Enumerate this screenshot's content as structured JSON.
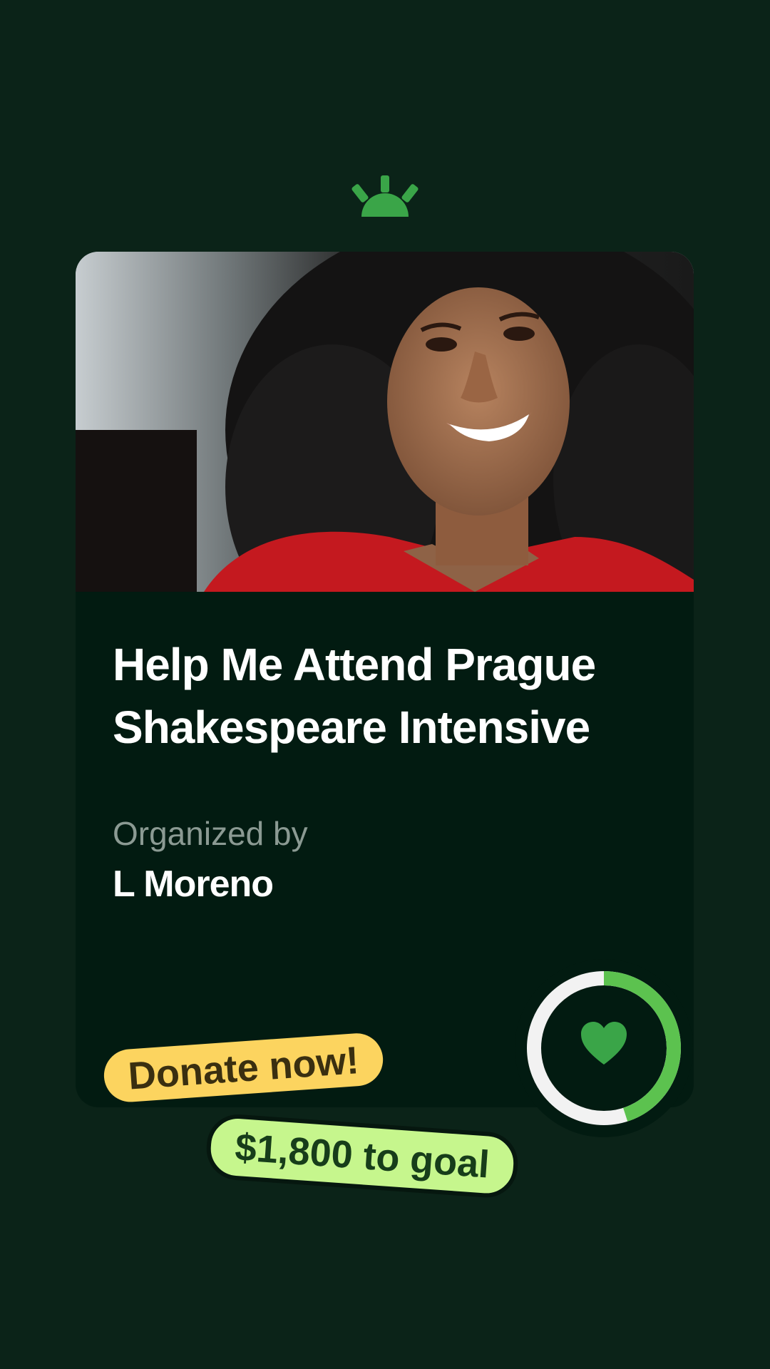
{
  "brand": {
    "logo_icon": "sun-rise-logo-icon",
    "accent_color": "#3aa548"
  },
  "campaign": {
    "title": "Help Me Attend Prague Shakespeare Intensive",
    "organized_label": "Organized by",
    "organizer": "L Moreno",
    "photo": "portrait-photo"
  },
  "progress": {
    "icon": "heart-icon",
    "fraction": 0.45
  },
  "badges": {
    "donate": "Donate now!",
    "goal": "$1,800 to goal"
  },
  "colors": {
    "background": "#0b2318",
    "card": "#021b11",
    "donate_badge": "#fcd45f",
    "goal_badge": "#c6f68d"
  }
}
